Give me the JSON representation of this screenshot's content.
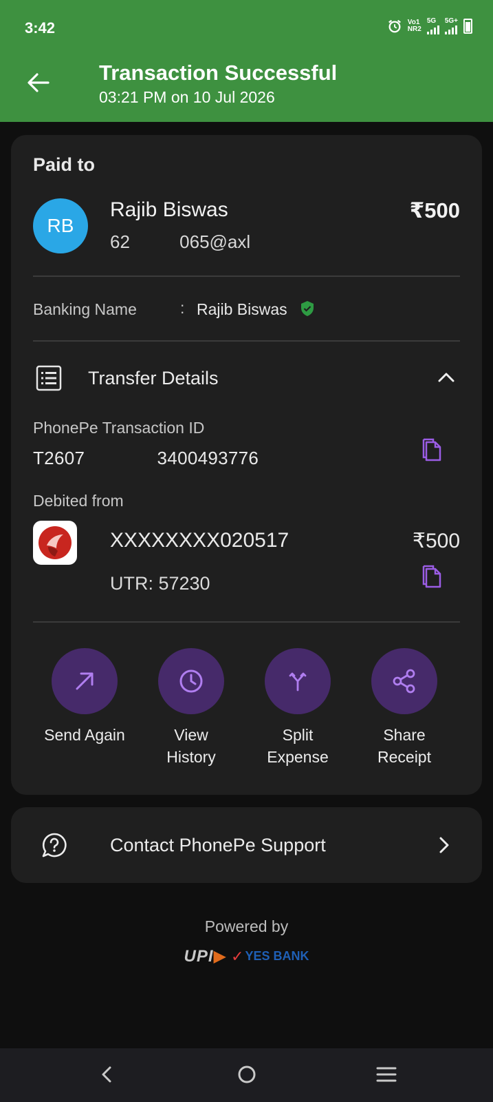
{
  "status_bar": {
    "time": "3:42",
    "sim1": [
      "Vo1",
      "NR2"
    ],
    "sim1_type": "5G",
    "sim2_type": "5G+"
  },
  "header": {
    "title": "Transaction Successful",
    "subtitle": "03:21 PM on 10 Jul 2026",
    "background": "#3e9140"
  },
  "payment": {
    "section_label": "Paid to",
    "avatar_initials": "RB",
    "avatar_color": "#2aa7e6",
    "payee_name": "Rajib Biswas",
    "payee_vpa": "62          065@axl",
    "amount": "₹500"
  },
  "banking_name": {
    "label": "Banking Name",
    "separator": ":",
    "value": "Rajib Biswas",
    "verified_icon": "verified-shield-icon"
  },
  "transfer_details": {
    "title": "Transfer Details",
    "transaction_id_label": "PhonePe Transaction ID",
    "transaction_id": "T2607              3400493776",
    "debited_from_label": "Debited from",
    "account_number": "XXXXXXXX020517",
    "debit_amount": "₹500",
    "utr": "UTR: 57230"
  },
  "actions": [
    {
      "label": "Send Again"
    },
    {
      "label": "View\nHistory"
    },
    {
      "label": "Split\nExpense"
    },
    {
      "label": "Share\nReceipt"
    }
  ],
  "support": {
    "label": "Contact PhonePe Support"
  },
  "footer": {
    "powered_by": "Powered by",
    "upi_text": "UPI",
    "bank_text": "YES BANK"
  },
  "colors": {
    "accent_purple": "#9b5de5",
    "action_circle": "#462a6a",
    "card_bg": "#1f1f1f",
    "verified_green": "#2e9b43"
  }
}
